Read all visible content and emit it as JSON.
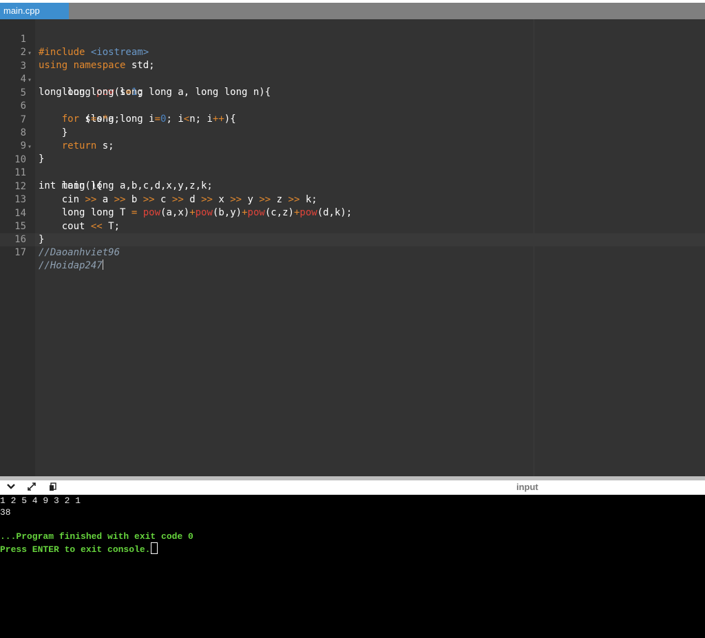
{
  "tab": {
    "label": "main.cpp"
  },
  "code": {
    "l1": {
      "n": "1",
      "p1": "#include ",
      "p2": "<iostream>"
    },
    "l2": {
      "n": "2",
      "p1": "using namespace",
      "p2": " std;"
    },
    "l3": {
      "n": "3",
      "p1": "long long ",
      "p2": "pow",
      "p3": "(long long a, long long n){"
    },
    "l4": {
      "n": "4",
      "p1": "    long long s",
      "p2": "=",
      "p3": "1",
      "p4": ";"
    },
    "l5": {
      "n": "5",
      "p1": "    ",
      "p2": "for",
      "p3": " (long long i",
      "p4": "=",
      "p5": "0",
      "p6": "; i",
      "p7": "<",
      "p8": "n; i",
      "p9": "++",
      "p10": "){"
    },
    "l6": {
      "n": "6",
      "p1": "        s",
      "p2": "=",
      "p3": "s",
      "p4": "*",
      "p5": "a;"
    },
    "l7": {
      "n": "7",
      "p1": "    }"
    },
    "l8": {
      "n": "8",
      "p1": "    ",
      "p2": "return",
      "p3": " s;"
    },
    "l9": {
      "n": "9",
      "p1": "}"
    },
    "l10": {
      "n": "10",
      "p1": "int main(){"
    },
    "l11": {
      "n": "11",
      "p1": "    long long a,b,c,d,x,y,z,k;"
    },
    "l12": {
      "n": "12",
      "p1": "    cin ",
      "p2": ">>",
      "p3": " a ",
      "p4": ">>",
      "p5": " b ",
      "p6": ">>",
      "p7": " c ",
      "p8": ">>",
      "p9": " d ",
      "p10": ">>",
      "p11": " x ",
      "p12": ">>",
      "p13": " y ",
      "p14": ">>",
      "p15": " z ",
      "p16": ">>",
      "p17": " k;"
    },
    "l13": {
      "n": "13",
      "p1": "    long long T ",
      "p2": "=",
      "p3": " ",
      "p4": "pow",
      "p5": "(a,x)",
      "p6": "+",
      "p7": "pow",
      "p8": "(b,y)",
      "p9": "+",
      "p10": "pow",
      "p11": "(c,z)",
      "p12": "+",
      "p13": "pow",
      "p14": "(d,k);"
    },
    "l14": {
      "n": "14",
      "p1": "    cout ",
      "p2": "<<",
      "p3": " T;"
    },
    "l15": {
      "n": "15",
      "p1": "}"
    },
    "l16": {
      "n": "16",
      "p1": "//Daoanhviet96"
    },
    "l17": {
      "n": "17",
      "p1": "//Hoidap247"
    }
  },
  "console_bar": {
    "collapse_icon": "chevron-down-icon",
    "expand_icon": "expand-arrows-icon",
    "copy_icon": "copy-icon",
    "input_label": "input"
  },
  "console": {
    "input_line": "1 2 5 4 9 3 2 1",
    "output_line": "38",
    "finished_line": "...Program finished with exit code 0",
    "exit_line": "Press ENTER to exit console."
  },
  "colors": {
    "tab_active": "#3d8ecf",
    "editor_bg": "#333333",
    "keyword": "#e3892e",
    "function": "#e0443a",
    "number": "#4f86c2",
    "console_green": "#66d43d"
  }
}
